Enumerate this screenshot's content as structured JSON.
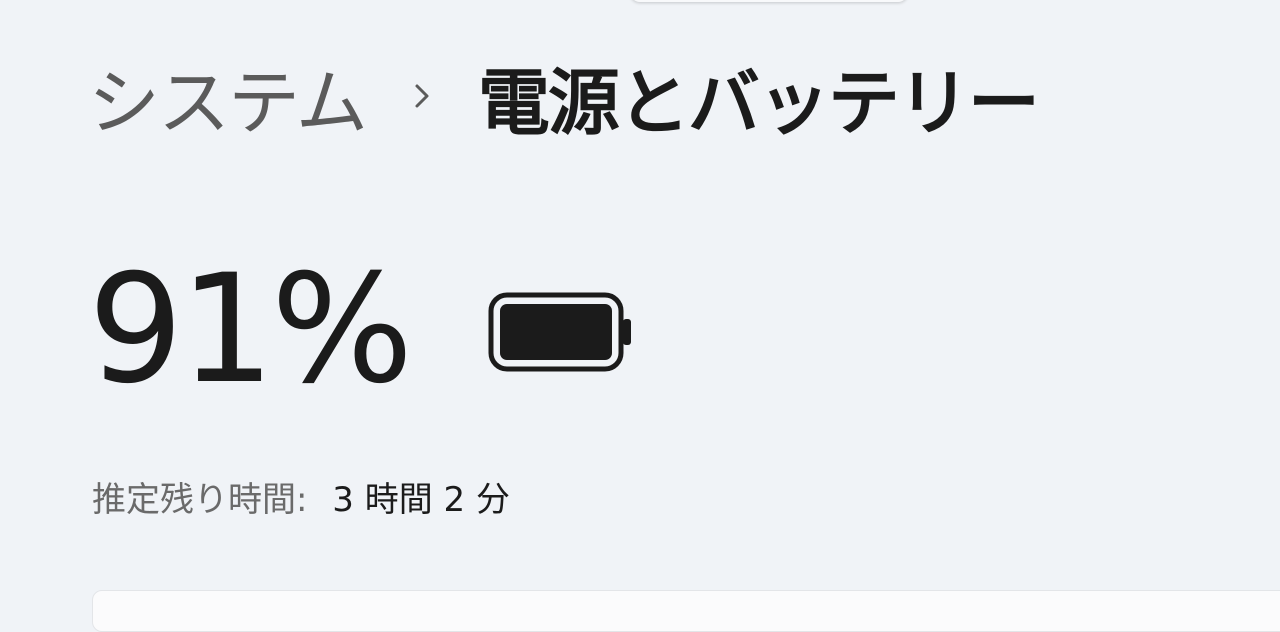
{
  "breadcrumb": {
    "parent": "システム",
    "separator_icon": "chevron-right-icon",
    "current": "電源とバッテリー"
  },
  "battery": {
    "percent_text": "91%",
    "level": 0.91,
    "icon": "battery-icon",
    "estimate_label": "推定残り時間:",
    "estimate_value": "3 時間 2 分"
  },
  "colors": {
    "background": "#f0f3f7",
    "text_primary": "#1b1b1b",
    "text_secondary": "#5b5b5b"
  }
}
